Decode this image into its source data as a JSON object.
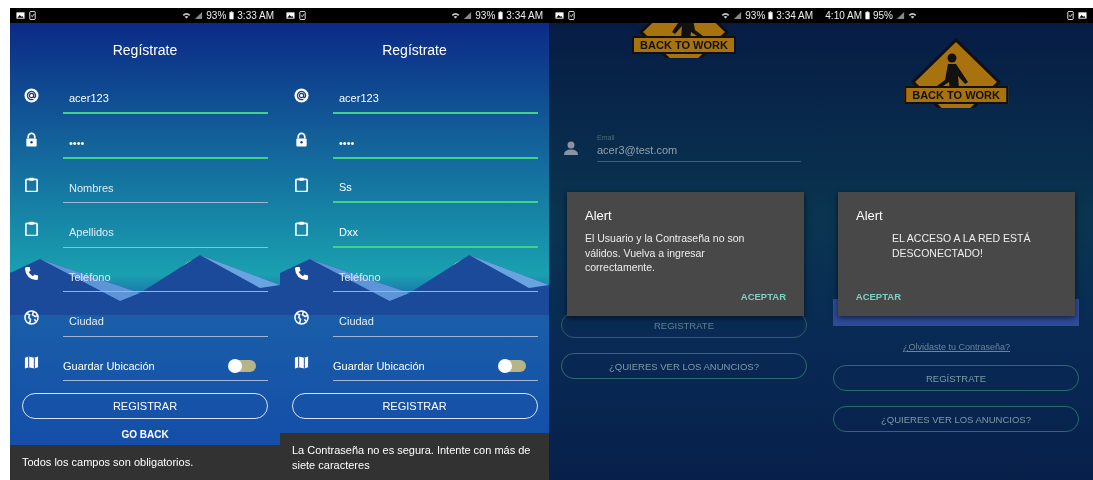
{
  "screens": [
    {
      "kind": "form",
      "mirrored": false,
      "status_bar": {
        "battery": "93%",
        "time": "3:33 AM"
      },
      "title": "Regístrate",
      "fields": [
        {
          "kind": "user",
          "value": "acer123"
        },
        {
          "kind": "password",
          "value": "••••"
        },
        {
          "kind": "name",
          "placeholder": "Nombres"
        },
        {
          "kind": "name",
          "placeholder": "Apellidos"
        },
        {
          "kind": "phone",
          "placeholder": "Teléfono"
        },
        {
          "kind": "city",
          "placeholder": "Ciudad"
        },
        {
          "kind": "toggle",
          "label": "Guardar Ubicación",
          "on": false
        }
      ],
      "buttons": [
        {
          "kind": "outline",
          "label": "REGISTRAR"
        },
        {
          "kind": "text",
          "label": "GO BACK"
        }
      ],
      "snackbar": "Todos los campos son obligatorios."
    },
    {
      "kind": "form",
      "mirrored": false,
      "status_bar": {
        "battery": "93%",
        "time": "3:34 AM"
      },
      "title": "Regístrate",
      "fields": [
        {
          "kind": "user",
          "value": "acer123"
        },
        {
          "kind": "password",
          "value": "••••"
        },
        {
          "kind": "name",
          "value": "Ss"
        },
        {
          "kind": "name",
          "value": "Dxx"
        },
        {
          "kind": "phone",
          "placeholder": "Teléfono"
        },
        {
          "kind": "city",
          "placeholder": "Ciudad"
        },
        {
          "kind": "toggle",
          "label": "Guardar Ubicación",
          "on": false
        }
      ],
      "buttons": [
        {
          "kind": "outline",
          "label": "REGISTRAR"
        }
      ],
      "snackbar": "La Contraseña no es segura. Intente con más de siete caracteres"
    },
    {
      "kind": "login",
      "mirrored": false,
      "status_bar": {
        "battery": "93%",
        "time": "3:34 AM"
      },
      "logo": "BACK TO WORK",
      "fields": [
        {
          "kind": "email",
          "label": "Email",
          "value": "acer3@test.com"
        }
      ],
      "buttons": [
        {
          "kind": "faded",
          "label": "REGISTRATE"
        },
        {
          "kind": "outline",
          "label": "¿QUIERES VER LOS ANUNCIOS?"
        }
      ],
      "dialog": {
        "title": "Alert",
        "message": "El Usuario y la Contraseña no son válidos. Vuelva a ingresar correctamente.",
        "action": "ACEPTAR"
      }
    },
    {
      "kind": "login",
      "mirrored": true,
      "status_bar": {
        "battery": "95%",
        "time": "4:10 AM"
      },
      "logo": "BACK TO WORK",
      "buttons": [
        {
          "kind": "filled"
        },
        {
          "kind": "link",
          "label": "¿Olvidaste tu Contraseña?"
        },
        {
          "kind": "outline",
          "label": "REGÍSTRATE"
        },
        {
          "kind": "outline",
          "label": "¿QUIERES VER LOS ANUNCIOS?"
        }
      ],
      "dialog": {
        "title": "Alert",
        "message": "EL ACCESO A LA RED ESTÁ DESCONECTADO!",
        "action": "ACEPTAR"
      }
    }
  ]
}
